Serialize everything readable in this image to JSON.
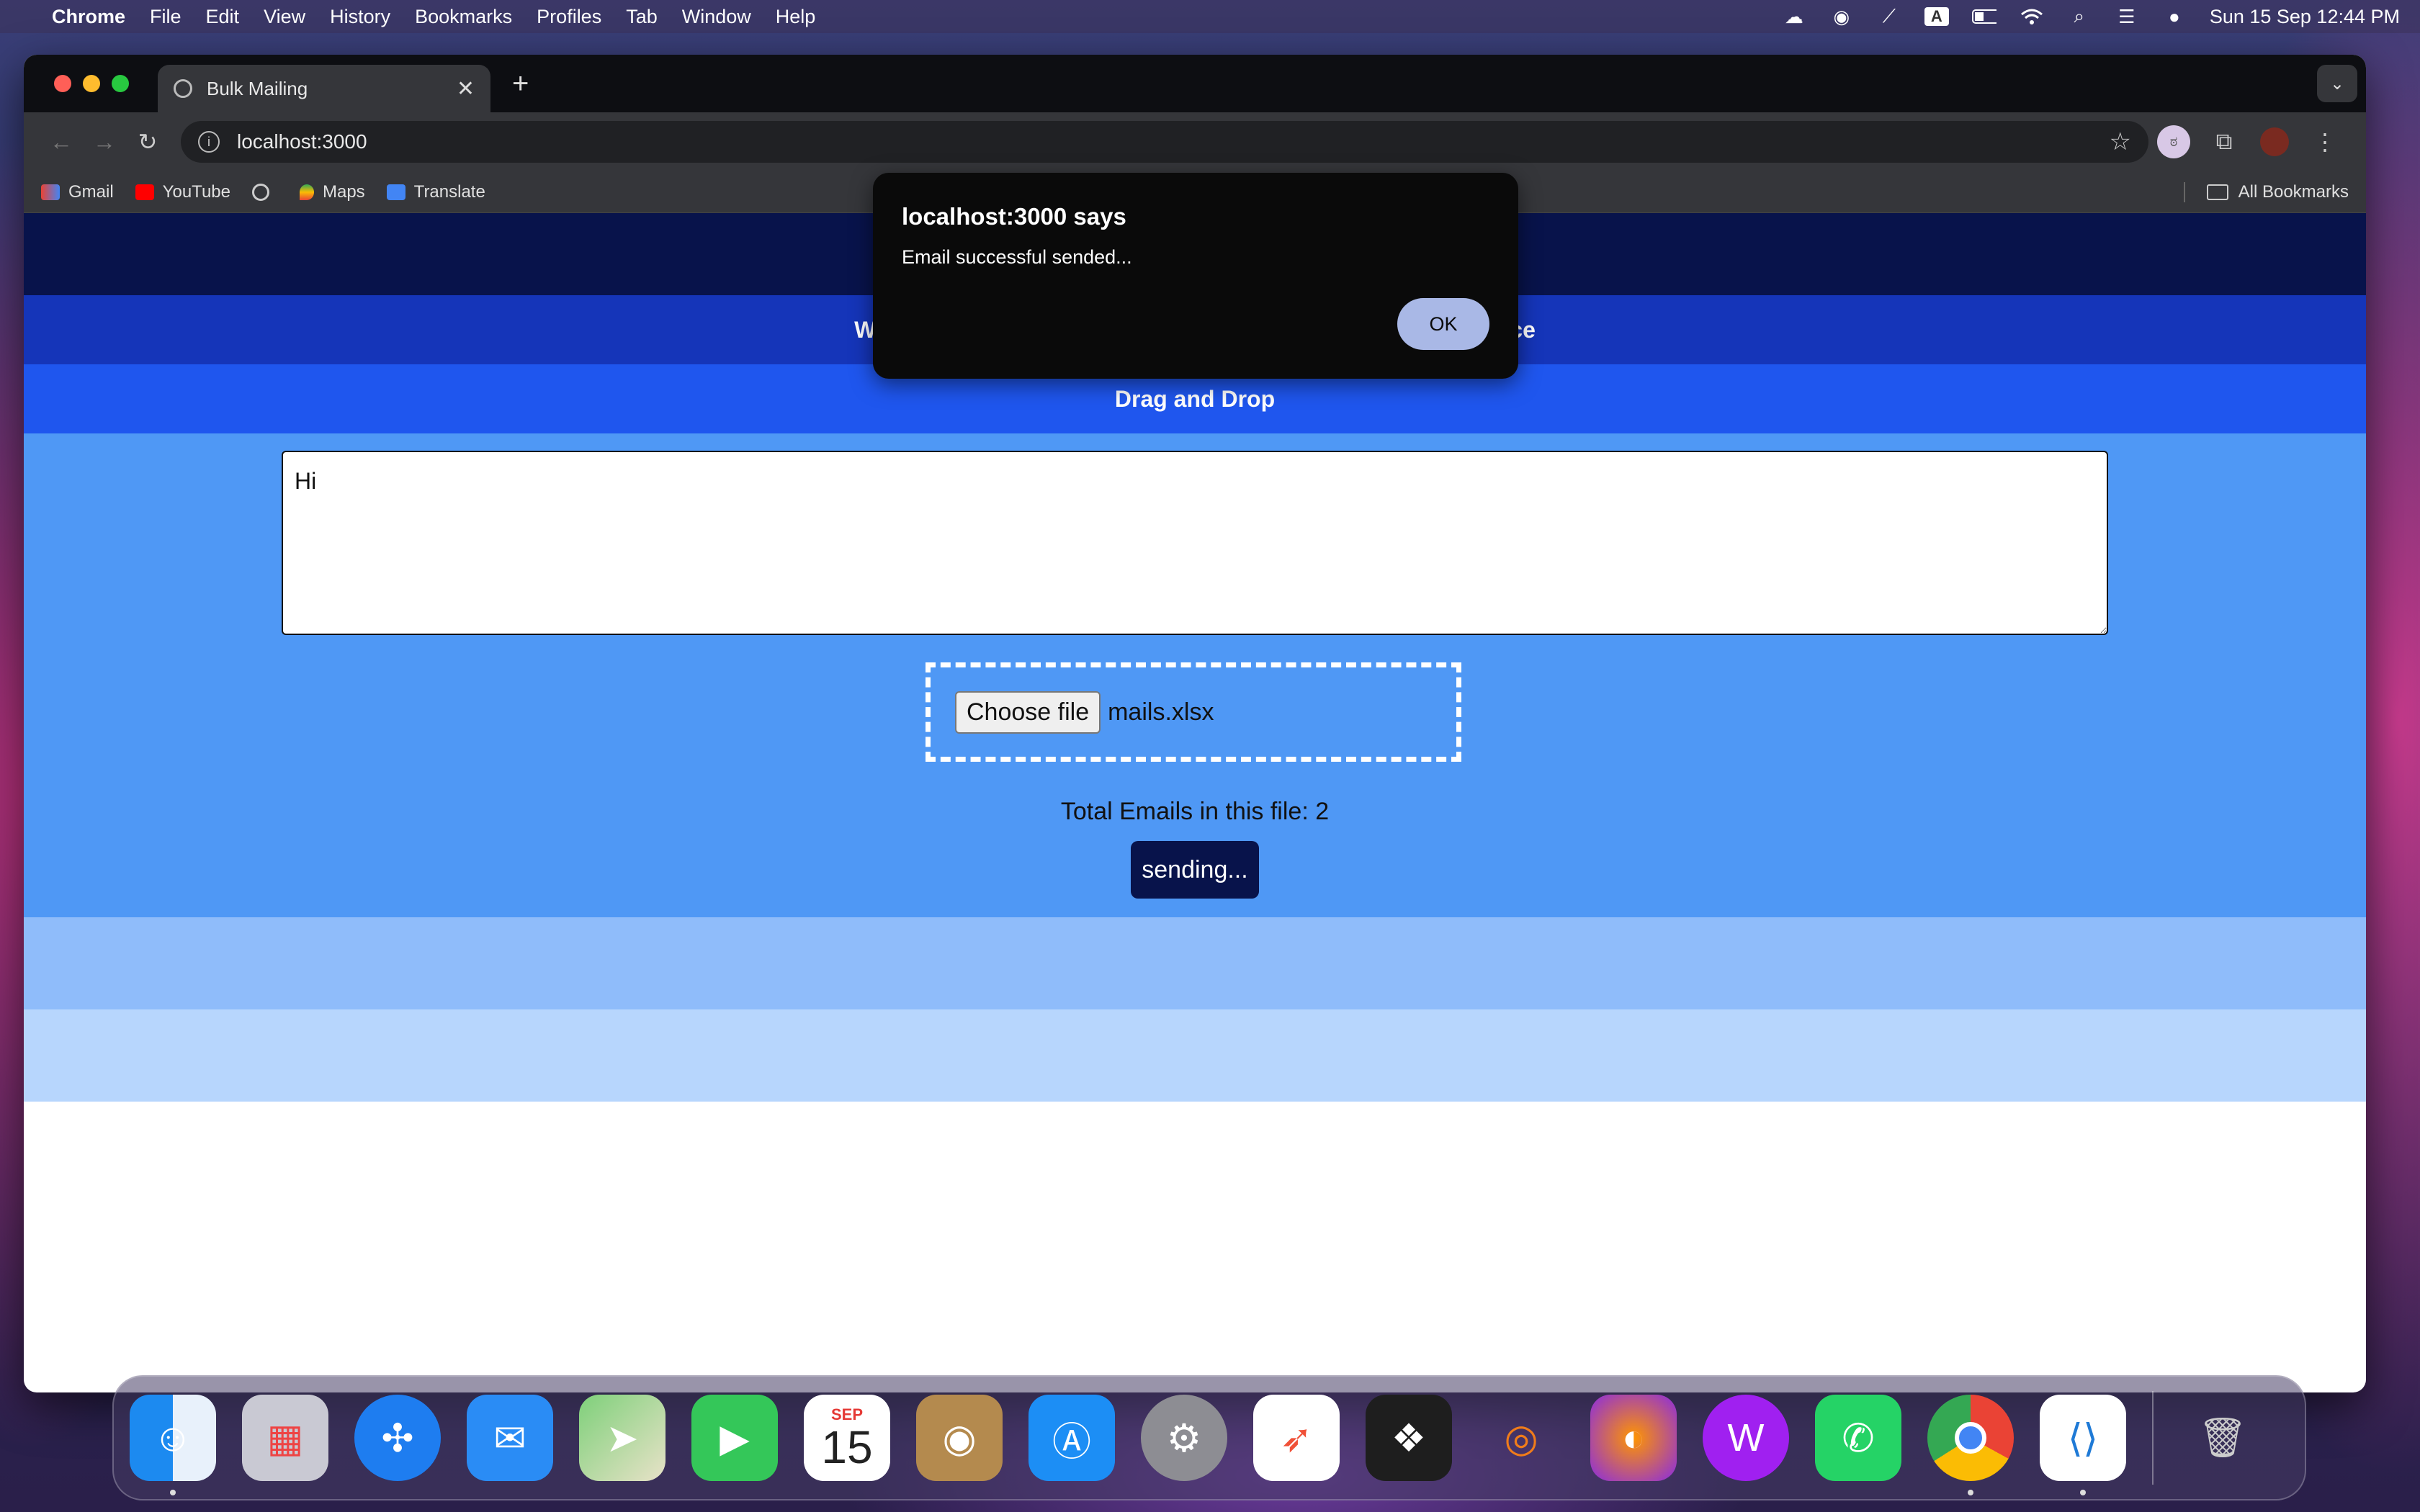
{
  "menubar": {
    "app": "Chrome",
    "items": [
      "File",
      "Edit",
      "View",
      "History",
      "Bookmarks",
      "Profiles",
      "Tab",
      "Window",
      "Help"
    ],
    "clock": "Sun 15 Sep  12:44 PM",
    "input_indicator": "A"
  },
  "browser": {
    "tab_title": "Bulk Mailing",
    "url": "localhost:3000",
    "bookmarks": [
      "Gmail",
      "YouTube",
      "Maps",
      "Translate"
    ],
    "all_bookmarks": "All Bookmarks"
  },
  "page": {
    "drag_drop": "Drag and Drop",
    "band_text_left": "W",
    "band_text_right": "ce",
    "textarea_value": "Hi",
    "choose_file_label": "Choose file",
    "file_name": "mails.xlsx",
    "total_emails": "Total Emails in this file: 2",
    "send_button": "sending..."
  },
  "alert": {
    "title": "localhost:3000 says",
    "message": "Email successful sended...",
    "ok": "OK"
  },
  "calendar": {
    "month": "SEP",
    "day": "15"
  },
  "dock": [
    "finder",
    "launchpad",
    "safari",
    "mail",
    "maps",
    "facetime",
    "calendar",
    "contacts",
    "app-store",
    "system-settings",
    "swift",
    "figma",
    "blender",
    "firefox",
    "wps",
    "whatsapp",
    "chrome",
    "vscode",
    "trash"
  ],
  "colors": {
    "navy": "#08134b",
    "blue1": "#1535b9",
    "blue2": "#1f56ee",
    "blue3": "#4f98f5",
    "blue4": "#8fbcfa",
    "blue5": "#b7d6fd"
  }
}
